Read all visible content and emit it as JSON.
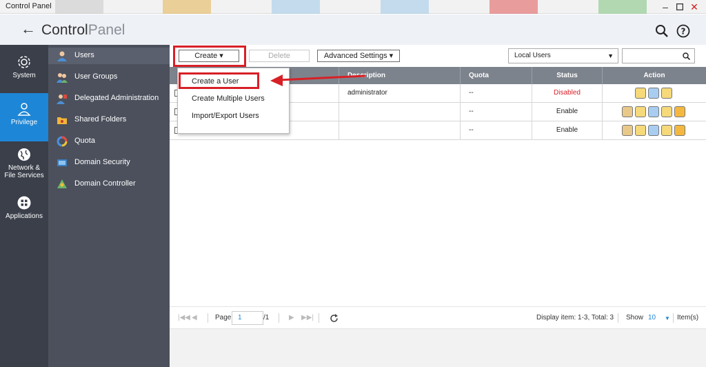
{
  "window": {
    "title": "Control Panel",
    "minimize_icon": "minimize-icon",
    "maximize_icon": "maximize-icon",
    "close_icon": "close-icon",
    "close_color": "#d21e1e"
  },
  "header": {
    "back_icon": "arrow-left-icon",
    "title_bold": "Control",
    "title_thin": "Panel",
    "search_icon": "search-icon",
    "help_icon": "help-icon"
  },
  "main_nav": [
    {
      "label": "System",
      "icon": "gear-icon",
      "active": false
    },
    {
      "label": "Privilege",
      "icon": "person-icon",
      "active": true
    },
    {
      "label_line1": "Network &",
      "label_line2": "File Services",
      "icon": "globe-icon",
      "active": false
    },
    {
      "label": "Applications",
      "icon": "grid-icon",
      "active": false
    }
  ],
  "sub_nav": [
    {
      "label": "Users",
      "icon": "user-icon",
      "active": true
    },
    {
      "label": "User Groups",
      "icon": "user-group-icon"
    },
    {
      "label": "Delegated Administration",
      "icon": "delegated-admin-icon"
    },
    {
      "label": "Shared Folders",
      "icon": "shared-folder-icon"
    },
    {
      "label": "Quota",
      "icon": "quota-icon"
    },
    {
      "label": "Domain Security",
      "icon": "domain-security-icon"
    },
    {
      "label": "Domain Controller",
      "icon": "domain-controller-icon"
    }
  ],
  "toolbar": {
    "create_label": "Create",
    "delete_label": "Delete",
    "advanced_label": "Advanced Settings",
    "user_scope_value": "Local Users",
    "search_placeholder": ""
  },
  "create_menu": {
    "items": [
      "Create a User",
      "Create Multiple Users",
      "Import/Export Users"
    ],
    "highlighted": "Create a User"
  },
  "table": {
    "columns": [
      "Description",
      "Quota",
      "Status",
      "Action"
    ],
    "rows": [
      {
        "description": "administrator",
        "quota": "--",
        "status": "Disabled",
        "status_color": "#d81f26"
      },
      {
        "description": "",
        "quota": "--",
        "status": "Enable",
        "status_color": "#222222"
      },
      {
        "description": "",
        "quota": "--",
        "status": "Enable",
        "status_color": "#222222"
      }
    ]
  },
  "pager": {
    "page_label": "Page",
    "page_value": "1",
    "page_total": "/1",
    "display_text": "Display item: 1-3, Total: 3",
    "show_label": "Show",
    "show_value": "10",
    "items_label": "Item(s)"
  },
  "colors": {
    "accent": "#1e86d6",
    "highlight": "#d81f26",
    "nav_dark": "#3a3f4a",
    "nav_sub": "#4b505c"
  }
}
